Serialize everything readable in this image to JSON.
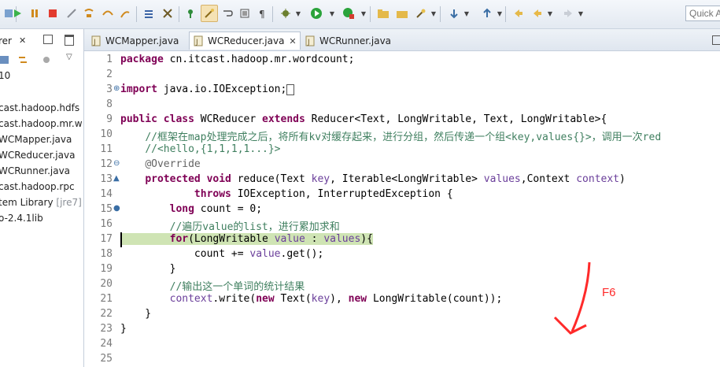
{
  "toolbar": {
    "quick_access_placeholder": "Quick A",
    "icons": [
      "skip-breakpoints",
      "resume",
      "suspend",
      "terminate",
      "disconnect",
      "step-into",
      "step-over",
      "step-return",
      "drop-to-frame",
      "use-step-filters",
      "open-console",
      "toggle-mark-occurrences",
      "toggle-word-wrap",
      "show-whitespace",
      "run-debug",
      "run",
      "run-dropdown",
      "coverage",
      "open-type",
      "open-task",
      "search",
      "next-annotation",
      "prev-annotation",
      "back",
      "forward"
    ]
  },
  "left_panel": {
    "tab_title": "rer",
    "tree": [
      {
        "label": "10"
      },
      {
        "label": "cast.hadoop.hdfs"
      },
      {
        "label": "cast.hadoop.mr.w"
      },
      {
        "label": "WCMapper.java"
      },
      {
        "label": "WCReducer.java"
      },
      {
        "label": "WCRunner.java"
      },
      {
        "label": "cast.hadoop.rpc"
      },
      {
        "label": "tem Library",
        "suffix": "[jre7]"
      },
      {
        "label": "o-2.4.1lib"
      }
    ]
  },
  "editor": {
    "tabs": [
      {
        "label": "WCMapper.java",
        "active": false
      },
      {
        "label": "WCReducer.java",
        "active": true
      },
      {
        "label": "WCRunner.java",
        "active": false
      }
    ],
    "lines": [
      {
        "n": "1",
        "html": "<span class='k'>package</span> cn.itcast.hadoop.mr.wordcount;"
      },
      {
        "n": "2",
        "html": ""
      },
      {
        "n": "3",
        "marker": "⊕",
        "html": "<span class='k'>import</span> java.io.IOException;<span style='display:inline-block;width:8px;height:12px;border:1px solid #555;vertical-align:middle'></span>"
      },
      {
        "n": "8",
        "html": ""
      },
      {
        "n": "9",
        "html": "<span class='k'>public class</span> WCReducer <span class='k'>extends</span> Reducer&lt;Text, LongWritable, Text, LongWritable&gt;{"
      },
      {
        "n": "10",
        "html": "    <span class='c'>//框架在map处理完成之后，将所有kv对缓存起来，进行分组，然后传递一个组&lt;key,values{}&gt;，调用一次red</span>"
      },
      {
        "n": "11",
        "html": "    <span class='c'>//&lt;hello,{1,1,1,1...}&gt;</span>"
      },
      {
        "n": "12",
        "marker": "⊖",
        "html": "    <span class='a'>@Override</span>"
      },
      {
        "n": "13",
        "marker": "▲",
        "html": "    <span class='k'>protected void</span> reduce(Text <span class='v'>key</span>, Iterable&lt;LongWritable&gt; <span class='v'>values</span>,Context <span class='v'>context</span>)"
      },
      {
        "n": "14",
        "html": "            <span class='k'>throws</span> IOException, InterruptedException {"
      },
      {
        "n": "15",
        "marker": "●",
        "html": "        <span class='k'>long</span> count = 0;"
      },
      {
        "n": "16",
        "html": "        <span class='c'>//遍历value的list，进行累加求和</span>"
      },
      {
        "n": "17",
        "hl": true,
        "html": "        <span class='k'>for</span>(LongWritable <span class='v'>value</span> : <span class='v'>values</span>){"
      },
      {
        "n": "18",
        "html": "            count += <span class='v'>value</span>.get();"
      },
      {
        "n": "19",
        "html": "        }"
      },
      {
        "n": "20",
        "html": "        <span class='c'>//输出这一个单词的统计结果</span>"
      },
      {
        "n": "21",
        "html": "        <span class='v'>context</span>.write(<span class='k'>new</span> Text(<span class='v'>key</span>), <span class='k'>new</span> LongWritable(count));"
      },
      {
        "n": "22",
        "html": "    }"
      },
      {
        "n": "23",
        "html": "}"
      },
      {
        "n": "24",
        "html": ""
      },
      {
        "n": "25",
        "html": ""
      }
    ]
  },
  "annotation": {
    "label": "F6",
    "color": "#ff2a2a"
  }
}
